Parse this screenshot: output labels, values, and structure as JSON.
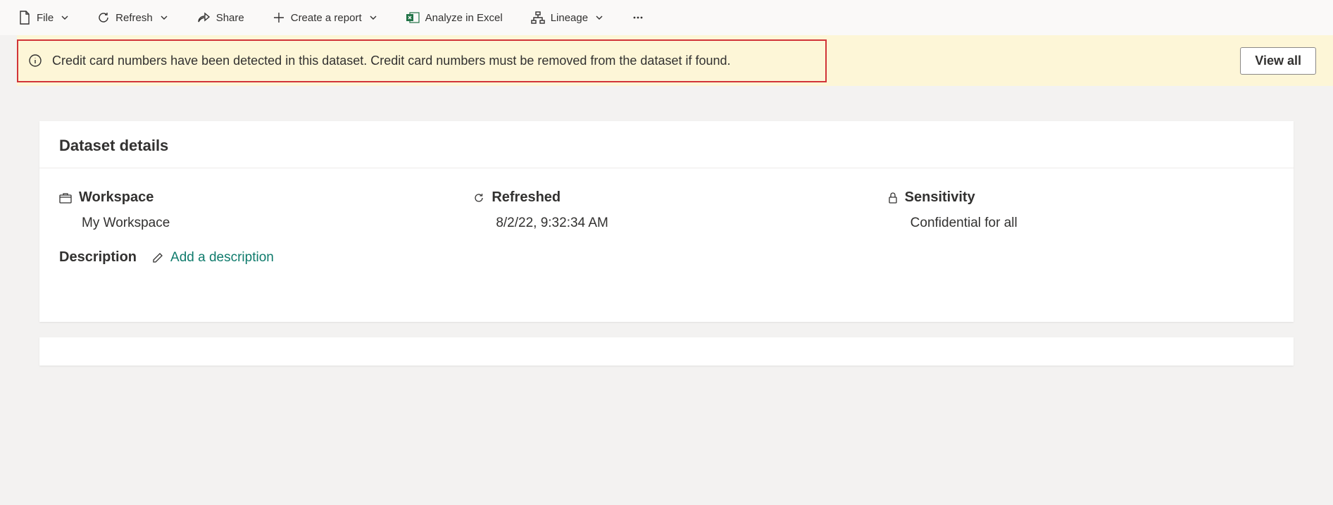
{
  "toolbar": {
    "file": "File",
    "refresh": "Refresh",
    "share": "Share",
    "create_report": "Create a report",
    "analyze_excel": "Analyze in Excel",
    "lineage": "Lineage"
  },
  "banner": {
    "message": "Credit card numbers have been detected in this dataset. Credit card numbers must be removed from the dataset if found.",
    "view_all": "View all"
  },
  "details": {
    "title": "Dataset details",
    "workspace_label": "Workspace",
    "workspace_value": "My Workspace",
    "refreshed_label": "Refreshed",
    "refreshed_value": "8/2/22, 9:32:34 AM",
    "sensitivity_label": "Sensitivity",
    "sensitivity_value": "Confidential for all",
    "description_label": "Description",
    "add_description": "Add a description"
  }
}
